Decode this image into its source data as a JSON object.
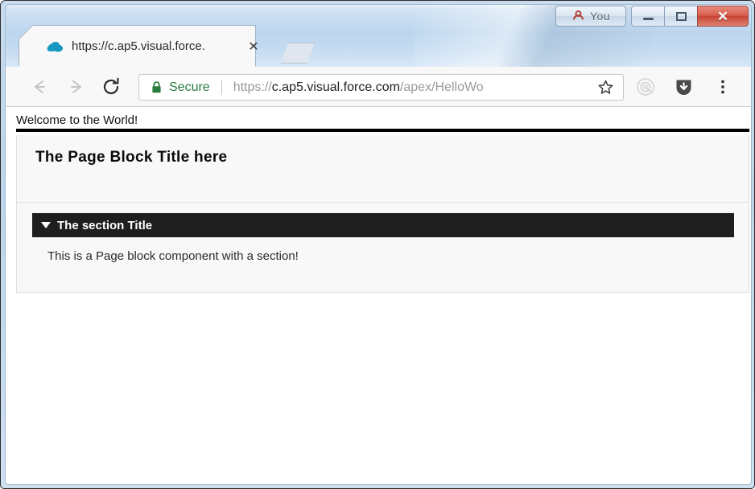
{
  "window": {
    "profile_button_label": "You",
    "profile_icon": "person-icon",
    "minimize_label": "",
    "maximize_label": "",
    "close_label": "✕"
  },
  "tabs": [
    {
      "title": "https://c.ap5.visual.force.",
      "favicon": "salesforce-cloud-icon",
      "close_label": "✕",
      "active": true
    }
  ],
  "new_tab": {
    "label": ""
  },
  "toolbar": {
    "back_label": "←",
    "forward_label": "→",
    "reload_label": "⟳",
    "security_label": "Secure",
    "lock_icon": "padlock-icon",
    "url_prefix": "https://",
    "url_host": "c.ap5.visual.force.com",
    "url_path": "/apex/HelloWo",
    "url_full": "https://c.ap5.visual.force.com/apex/HelloWo",
    "star_icon": "star-outline-icon",
    "extension_1_icon": "extension-circle-icon",
    "extension_2_icon": "shield-download-icon",
    "menu_icon": "three-dot-menu-icon"
  },
  "page": {
    "welcome_text": "Welcome to the World!",
    "block_title": "The Page Block Title here",
    "section": {
      "toggle_icon": "triangle-down-icon",
      "title": "The section Title",
      "body": "This is a Page block component with a section!"
    }
  },
  "colors": {
    "titlebar_top": "#e6f0fa",
    "titlebar_bottom": "#d8e8f7",
    "close_button": "#c64332",
    "secure_green": "#2a7d3f",
    "section_header_bg": "#1e1e1e",
    "page_block_bg": "#f8f8f8",
    "rule_black": "#000000"
  }
}
